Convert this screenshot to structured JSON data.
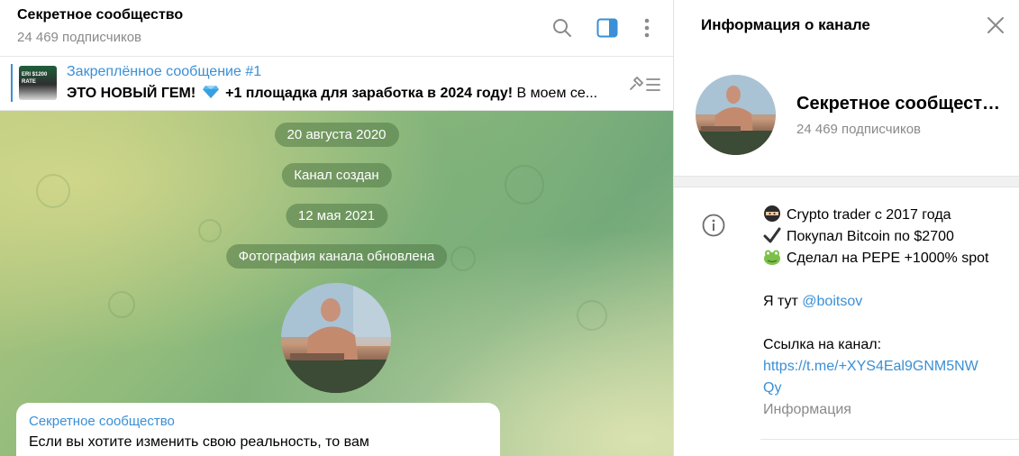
{
  "chat": {
    "title": "Секретное сообщество",
    "subscribers": "24 469 подписчиков"
  },
  "pinned": {
    "title": "Закреплённое сообщение #1",
    "text_bold": "ЭТО НОВЫЙ ГЕМ!",
    "text_after_emoji": " +1 площадка для заработка в 2024 году!",
    "text_rest": "  В моем се...",
    "thumb_caption_1": "ERI $1200",
    "thumb_caption_2": "RATE"
  },
  "messages": {
    "date1": "20 августа 2020",
    "service1": "Канал создан",
    "date2": "12 мая 2021",
    "service2": "Фотография канала обновлена",
    "bubble_author": "Секретное сообщество",
    "bubble_text": "Если вы хотите изменить свою реальность, то вам"
  },
  "info": {
    "panel_title": "Информация о канале",
    "name": "Секретное сообщество",
    "subscribers": "24 469 подписчиков",
    "desc_line1": "Crypto trader с 2017 года",
    "desc_line2": "Покупал Bitcoin по $2700",
    "desc_line3": "Сделал на PEPE +1000% spot",
    "here_prefix": "Я тут ",
    "here_handle": "@boitsov",
    "link_label": "Ссылка на канал:",
    "link_line1": "https://t.me/+XYS4Eal9GNM5NW",
    "link_line2": "Qy",
    "info_caption": "Информация"
  },
  "icons": [
    "search-icon",
    "sidebar-toggle-icon",
    "more-vertical-icon",
    "pin-list-icon",
    "close-icon",
    "info-icon",
    "ninja-emoji-icon",
    "check-emoji-icon",
    "frog-emoji-icon",
    "gem-emoji-icon"
  ],
  "colors": {
    "accent": "#3a8fd6",
    "muted": "#8a8a8a",
    "service_pill": "#507846"
  }
}
